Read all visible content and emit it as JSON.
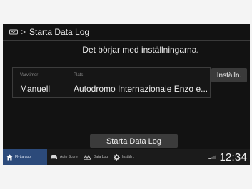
{
  "header": {
    "title": "Starta Data Log"
  },
  "subtitle": "Det börjar med inställningarna.",
  "settings_row": {
    "mode_label": "Varvtimer",
    "mode_value": "Manuell",
    "place_label": "Plats",
    "place_value": "Autodromo Internazionale Enzo e...",
    "settings_button": "Inställn."
  },
  "start_button": "Starta Data Log",
  "nav": {
    "items": [
      {
        "label": "Flytta upp",
        "icon": "home-icon"
      },
      {
        "label": "Auto Score",
        "icon": "car-icon"
      },
      {
        "label": "Data Log",
        "icon": "data-log-icon"
      },
      {
        "label": "Inställn.",
        "icon": "gear-icon"
      }
    ]
  },
  "status": {
    "time": "12:34"
  },
  "colors": {
    "screen_bg": "#121212",
    "active_nav": "#2c4a7a",
    "button_bg": "#3b3b3b"
  }
}
